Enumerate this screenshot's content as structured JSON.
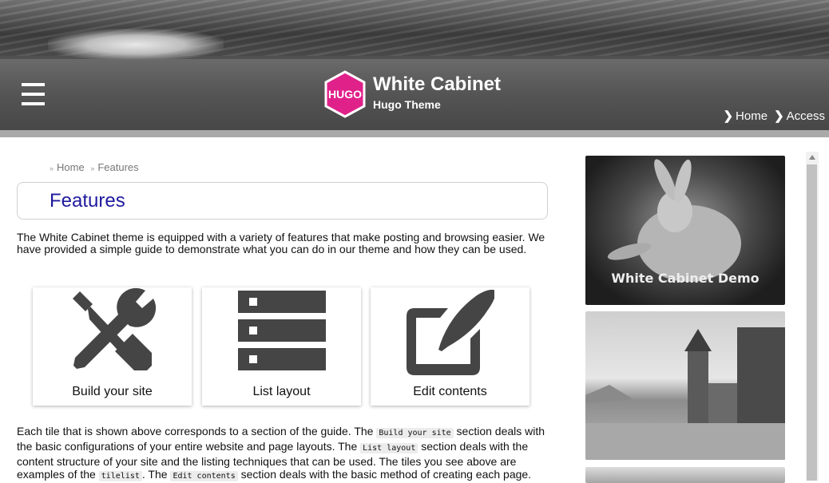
{
  "header": {
    "logo_text": "HUGO",
    "site_title": "White Cabinet",
    "site_subtitle": "Hugo Theme",
    "nav": [
      {
        "label": "Home"
      },
      {
        "label": "Access"
      }
    ],
    "logo_color": "#e0218a"
  },
  "breadcrumb": {
    "items": [
      "Home",
      "Features"
    ]
  },
  "page": {
    "title": "Features",
    "intro": "The White Cabinet theme is equipped with a variety of features that make posting and browsing easier. We have provided a simple guide to demonstrate what you can do in our theme and how they can be used.",
    "tiles": [
      {
        "label": "Build your site",
        "icon": "tools-icon"
      },
      {
        "label": "List layout",
        "icon": "server-list-icon"
      },
      {
        "label": "Edit contents",
        "icon": "edit-quill-icon"
      }
    ],
    "body": {
      "t1": "Each tile that is shown above corresponds to a section of the guide. The ",
      "c1": "Build your site",
      "t2": " section deals with the basic configurations of your entire website and page layouts. The ",
      "c2": "List layout",
      "t3": " section deals with the content structure of your site and the listing techniques that can be used. The tiles you see above are examples of the ",
      "c3": "tilelist",
      "t4": ". The ",
      "c4": "Edit contents",
      "t5": " section deals with the basic method of creating each page."
    }
  },
  "sidebar": {
    "images": [
      {
        "caption": "White Cabinet Demo"
      },
      {
        "caption": ""
      },
      {
        "caption": ""
      }
    ]
  }
}
